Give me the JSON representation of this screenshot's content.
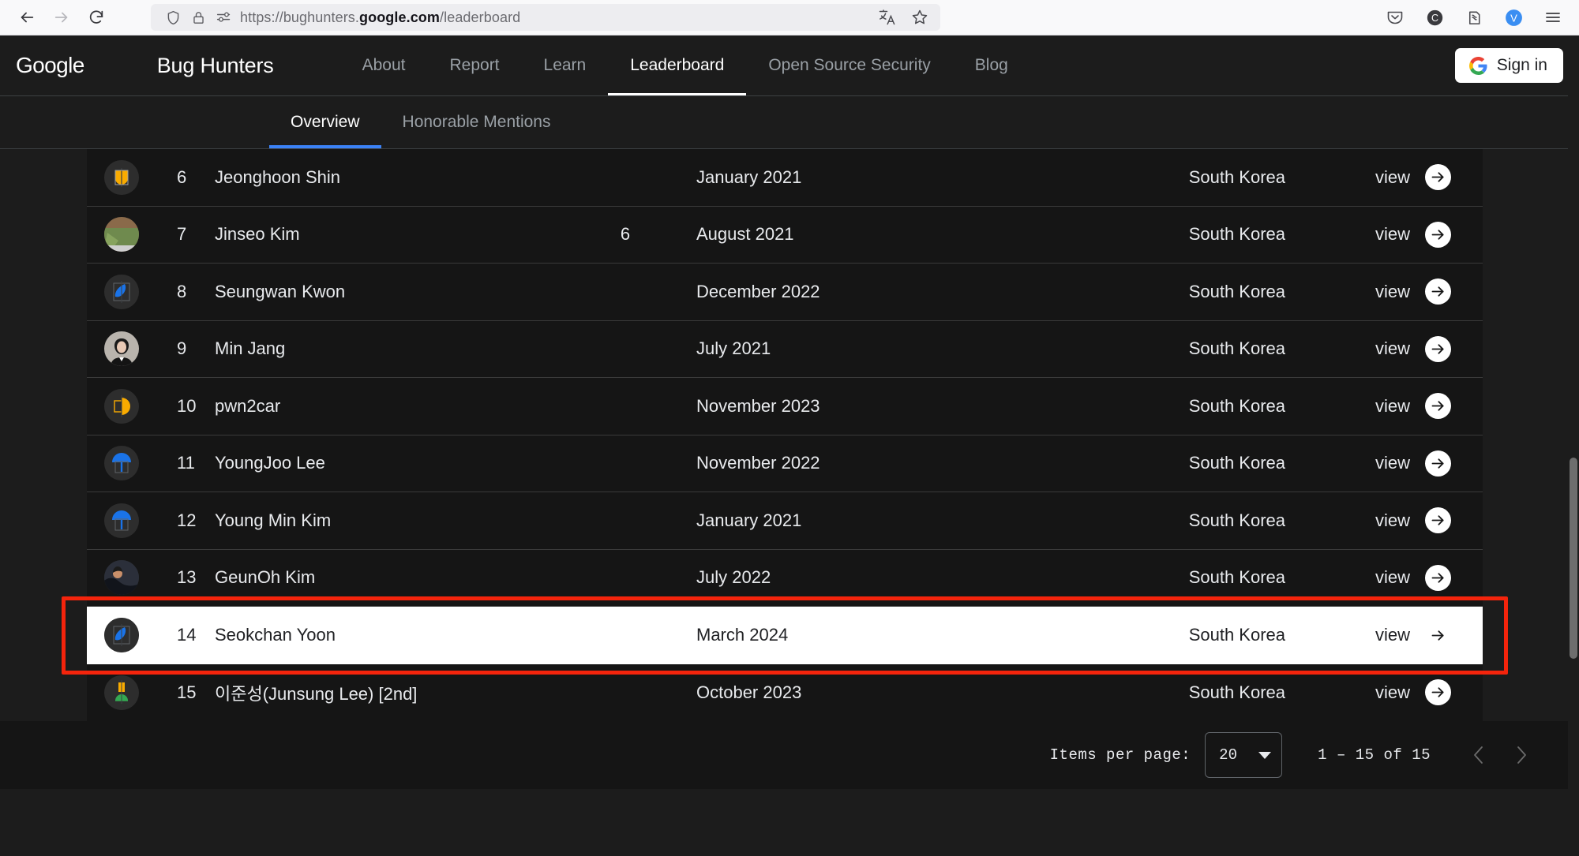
{
  "browser": {
    "url_prefix": "https://bughunters.",
    "url_bold": "google.com",
    "url_suffix": "/leaderboard",
    "icons": {
      "back": "back-arrow-icon",
      "forward": "forward-arrow-icon",
      "reload": "reload-icon",
      "shield": "shield-icon",
      "lock": "padlock-icon",
      "permissions": "permissions-icon",
      "translate": "translate-icon",
      "bookmark": "star-bookmark-icon",
      "pocket": "pocket-icon",
      "container": "container-icon",
      "extension": "extension-icon",
      "profile": "profile-icon",
      "menu": "hamburger-menu-icon"
    }
  },
  "header": {
    "google": "Google",
    "product": "Bug Hunters",
    "nav": [
      {
        "label": "About",
        "active": false
      },
      {
        "label": "Report",
        "active": false
      },
      {
        "label": "Learn",
        "active": false
      },
      {
        "label": "Leaderboard",
        "active": true
      },
      {
        "label": "Open Source Security",
        "active": false
      },
      {
        "label": "Blog",
        "active": false
      }
    ],
    "signin_label": "Sign in"
  },
  "tabs": [
    {
      "label": "Overview",
      "active": true
    },
    {
      "label": "Honorable Mentions",
      "active": false
    }
  ],
  "table": {
    "view_label": "view",
    "rows": [
      {
        "rank": "6",
        "name": "Jeonghoon Shin",
        "points": "",
        "date": "January 2021",
        "country": "South Korea",
        "avatar": "shield-yellow",
        "highlight": false
      },
      {
        "rank": "7",
        "name": "Jinseo Kim",
        "points": "6",
        "date": "August 2021",
        "country": "South Korea",
        "avatar": "photo-green",
        "highlight": false
      },
      {
        "rank": "8",
        "name": "Seungwan Kwon",
        "points": "",
        "date": "December 2022",
        "country": "South Korea",
        "avatar": "leaf-blue",
        "highlight": false
      },
      {
        "rank": "9",
        "name": "Min Jang",
        "points": "",
        "date": "July 2021",
        "country": "South Korea",
        "avatar": "photo-person",
        "highlight": false
      },
      {
        "rank": "10",
        "name": "pwn2car",
        "points": "",
        "date": "November 2023",
        "country": "South Korea",
        "avatar": "pac-yellow",
        "highlight": false
      },
      {
        "rank": "11",
        "name": "YoungJoo Lee",
        "points": "",
        "date": "November 2022",
        "country": "South Korea",
        "avatar": "umbrella-blue",
        "highlight": false
      },
      {
        "rank": "12",
        "name": "Young Min Kim",
        "points": "",
        "date": "January 2021",
        "country": "South Korea",
        "avatar": "umbrella-blue",
        "highlight": false
      },
      {
        "rank": "13",
        "name": "GeunOh Kim",
        "points": "",
        "date": "July 2022",
        "country": "South Korea",
        "avatar": "photo-dark",
        "highlight": false
      },
      {
        "rank": "14",
        "name": "Seokchan Yoon",
        "points": "",
        "date": "March 2024",
        "country": "South Korea",
        "avatar": "leaf-blue",
        "highlight": true
      },
      {
        "rank": "15",
        "name": "이준성(Junsung Lee) [2nd]",
        "points": "",
        "date": "October 2023",
        "country": "South Korea",
        "avatar": "flask-green",
        "highlight": false
      }
    ]
  },
  "pagination": {
    "items_per_page_label": "Items per page:",
    "items_per_page_value": "20",
    "range": "1 – 15 of 15",
    "prev_icon": "chevron-left-icon",
    "next_icon": "chevron-right-icon"
  },
  "colors": {
    "accent_blue": "#3b82f6",
    "annotation_red": "#f4240c",
    "page_bg": "#1c1c1c",
    "table_bg": "#151515"
  }
}
